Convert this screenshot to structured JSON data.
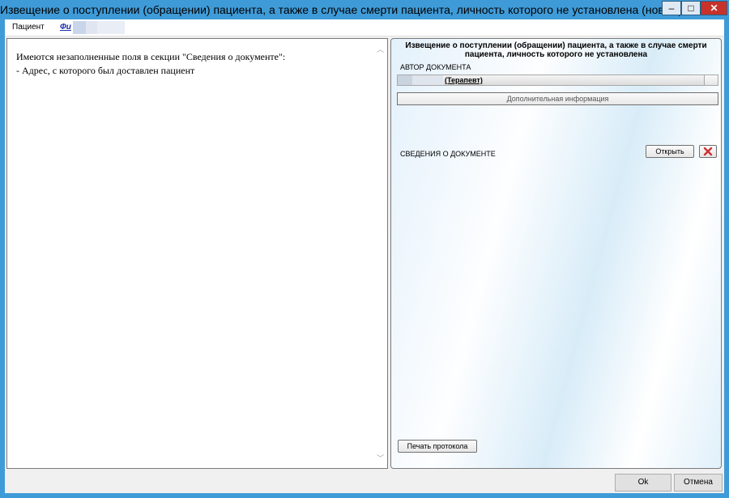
{
  "window": {
    "title": "Извещение о поступлении (обращении) пациента, а также в случае смерти пациента, личность которого не установлена (новый)",
    "min_glyph": "–",
    "max_glyph": "□",
    "close_glyph": "✕"
  },
  "menubar": {
    "patient_label": "Пациент",
    "patient_link": "Фи"
  },
  "left_panel": {
    "line1": "Имеются незаполненные поля в секции \"Сведения о документе\":",
    "line2": "- Адрес, с которого был доставлен пациент",
    "scroll_up": "︿",
    "scroll_down": "﹀"
  },
  "right_panel": {
    "doc_title": "Извещение о поступлении (обращении) пациента, а также в случае смерти пациента, личность которого не установлена",
    "author_label": "АВТОР ДОКУМЕНТА",
    "author_value": "(Терапевт)",
    "additional_info_button": "Дополнительная информация",
    "section_label": "СВЕДЕНИЯ О ДОКУМЕНТЕ",
    "open_button": "Открыть",
    "print_button": "Печать протокола"
  },
  "footer": {
    "ok_button": "Ok",
    "cancel_button": "Отмена"
  },
  "colors": {
    "titlebar": "#3f9bd8",
    "close_button": "#c7322a",
    "link": "#1a2fb0",
    "delete_icon": "#d03030"
  },
  "icons": [
    "minimize-icon",
    "maximize-icon",
    "close-icon",
    "delete-icon",
    "scroll-up-icon",
    "scroll-down-icon"
  ]
}
